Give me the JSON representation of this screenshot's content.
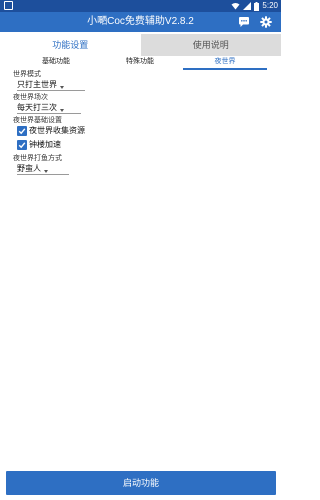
{
  "status_bar": {
    "time": "5:20",
    "icons": [
      "notification-icon",
      "wifi-icon",
      "signal-icon",
      "battery-icon"
    ]
  },
  "app_bar": {
    "title": "小嗮Coc免费辅助V2.8.2",
    "icons": [
      "chat-icon",
      "gear-icon"
    ]
  },
  "tabs": [
    {
      "label": "功能设置",
      "active": true
    },
    {
      "label": "使用说明",
      "active": false
    }
  ],
  "subtabs": [
    {
      "label": "基础功能",
      "active": false
    },
    {
      "label": "特殊功能",
      "active": false
    },
    {
      "label": "夜世界",
      "active": true
    }
  ],
  "form": {
    "world_mode_label": "世界模式",
    "world_mode_value": "只打主世界",
    "night_battles_label": "夜世界场次",
    "night_battles_value": "每天打三次",
    "night_settings_label": "夜世界基础设置",
    "collect_label": "夜世界收集资源",
    "collect_checked": true,
    "clock_label": "钟楼加速",
    "clock_checked": true,
    "fish_label": "夜世界打鱼方式",
    "fish_value": "野蛮人"
  },
  "footer": {
    "start_label": "启动功能"
  },
  "colors": {
    "accent": "#2e6fc3",
    "status_bar": "#1d4f9c",
    "inactive_tab": "#dcdcdc"
  }
}
